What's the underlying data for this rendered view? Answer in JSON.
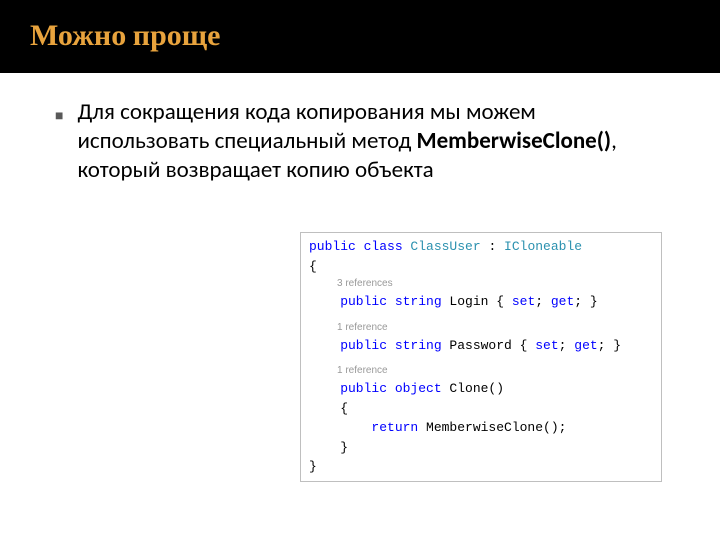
{
  "title": "Можно проще",
  "bullet": {
    "part1": "Для сокращения кода копирования мы можем использовать специальный метод ",
    "bold": "MemberwiseClone()",
    "part2": ", который возвращает копию объекта"
  },
  "code": {
    "l1a": "public",
    "l1b": " class",
    "l1c": " ClassUser",
    "l1d": " : ",
    "l1e": "ICloneable",
    "l2": "{",
    "ref1": "3 references",
    "l3a": "    public",
    "l3b": " string",
    "l3c": " Login { ",
    "l3d": "set",
    "l3e": "; ",
    "l3f": "get",
    "l3g": "; }",
    "ref2": "1 reference",
    "l4a": "    public",
    "l4b": " string",
    "l4c": " Password { ",
    "l4d": "set",
    "l4e": "; ",
    "l4f": "get",
    "l4g": "; }",
    "ref3": "1 reference",
    "l5a": "    public",
    "l5b": " object",
    "l5c": " Clone()",
    "l6": "    {",
    "l7a": "        return",
    "l7b": " MemberwiseClone();",
    "l8": "    }",
    "l9": "}"
  }
}
